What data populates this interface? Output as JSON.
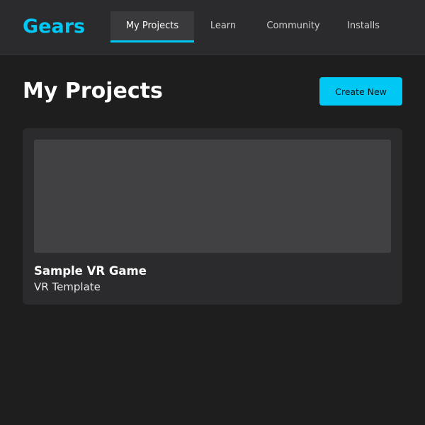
{
  "app": {
    "logo": "Gears"
  },
  "nav": {
    "tabs": [
      {
        "label": "My Projects",
        "active": true
      },
      {
        "label": "Learn",
        "active": false
      },
      {
        "label": "Community",
        "active": false
      },
      {
        "label": "Installs",
        "active": false
      }
    ]
  },
  "main": {
    "title": "My Projects",
    "create_label": "Create New",
    "projects": [
      {
        "name": "Sample VR Game",
        "template": "VR Template"
      }
    ]
  },
  "colors": {
    "accent": "#00c8f5",
    "background": "#1e1e1e",
    "header": "#2b2b2d",
    "card": "#2b2b2d",
    "thumbnail": "#414143"
  }
}
